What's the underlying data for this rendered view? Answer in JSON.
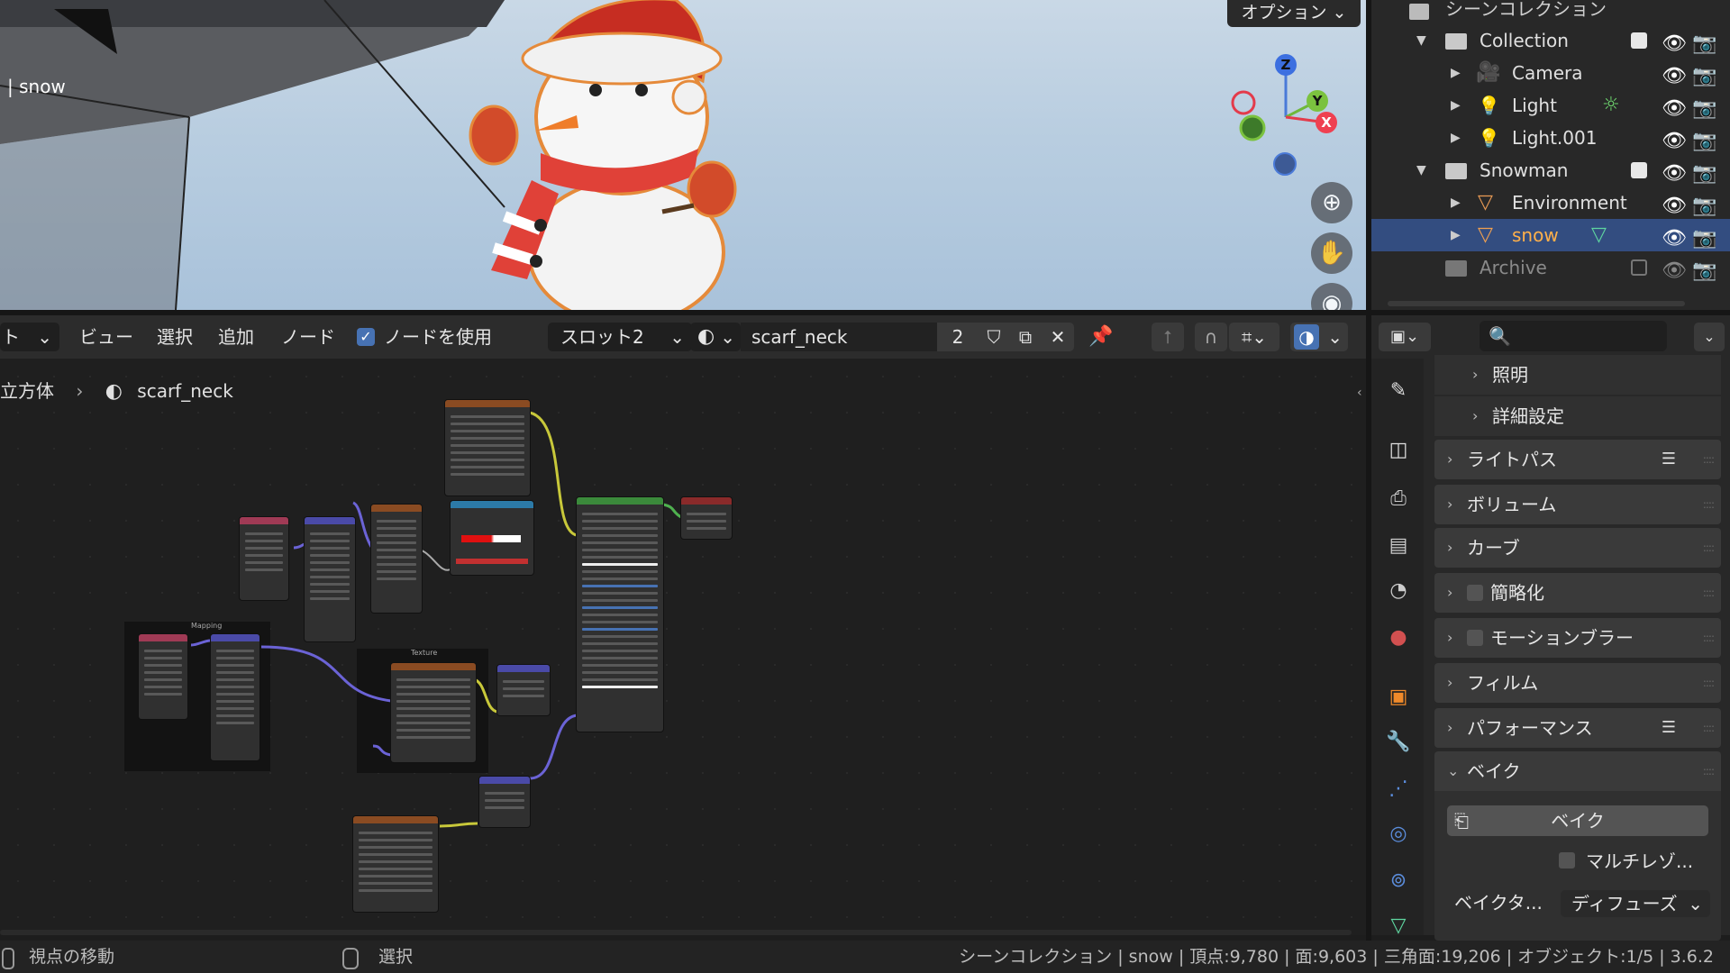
{
  "viewport": {
    "options_label": "オプション ⌄",
    "object_label": "| snow",
    "gizmo": {
      "z": "Z",
      "y": "Y",
      "x": "X"
    }
  },
  "outliner": {
    "title": "シーンコレクション",
    "rows": [
      {
        "label": "Collection"
      },
      {
        "label": "Camera"
      },
      {
        "label": "Light"
      },
      {
        "label": "Light.001"
      },
      {
        "label": "Snowman"
      },
      {
        "label": "Environment"
      },
      {
        "label": "snow"
      },
      {
        "label": "Archive"
      }
    ]
  },
  "node_header": {
    "mode_label": "ト",
    "menu": [
      "ビュー",
      "選択",
      "追加",
      "ノード"
    ],
    "use_nodes_label": "ノードを使用",
    "slot_label": "スロット2",
    "material_name": "scarf_neck",
    "user_count": "2"
  },
  "breadcrumb": {
    "object": "立方体",
    "material": "scarf_neck"
  },
  "node_frames": {
    "mapping": "Mapping",
    "texture": "Texture"
  },
  "properties": {
    "panels": [
      {
        "label": "照明"
      },
      {
        "label": "詳細設定"
      },
      {
        "label": "ライトパス"
      },
      {
        "label": "ボリューム"
      },
      {
        "label": "カーブ"
      },
      {
        "label": "簡略化"
      },
      {
        "label": "モーションブラー"
      },
      {
        "label": "フィルム"
      },
      {
        "label": "パフォーマンス"
      },
      {
        "label": "ベイク"
      }
    ],
    "bake_button": "ベイク",
    "multires_label": "マルチレゾ...",
    "bake_type_label": "ベイクタ...",
    "bake_type_value": "ディフューズ"
  },
  "status_bar": {
    "left_action": "視点の移動",
    "mid_action": "選択",
    "info": "シーンコレクション | snow | 頂点:9,780 | 面:9,603 | 三角面:19,206 | オブジェクト:1/5 | 3.6.2"
  },
  "colors": {
    "selection": "#334d80",
    "accent_orange": "#e58a3a",
    "wire_yellow": "#c8c83a",
    "wire_purple": "#6b63d6",
    "wire_green": "#4fb14f"
  }
}
